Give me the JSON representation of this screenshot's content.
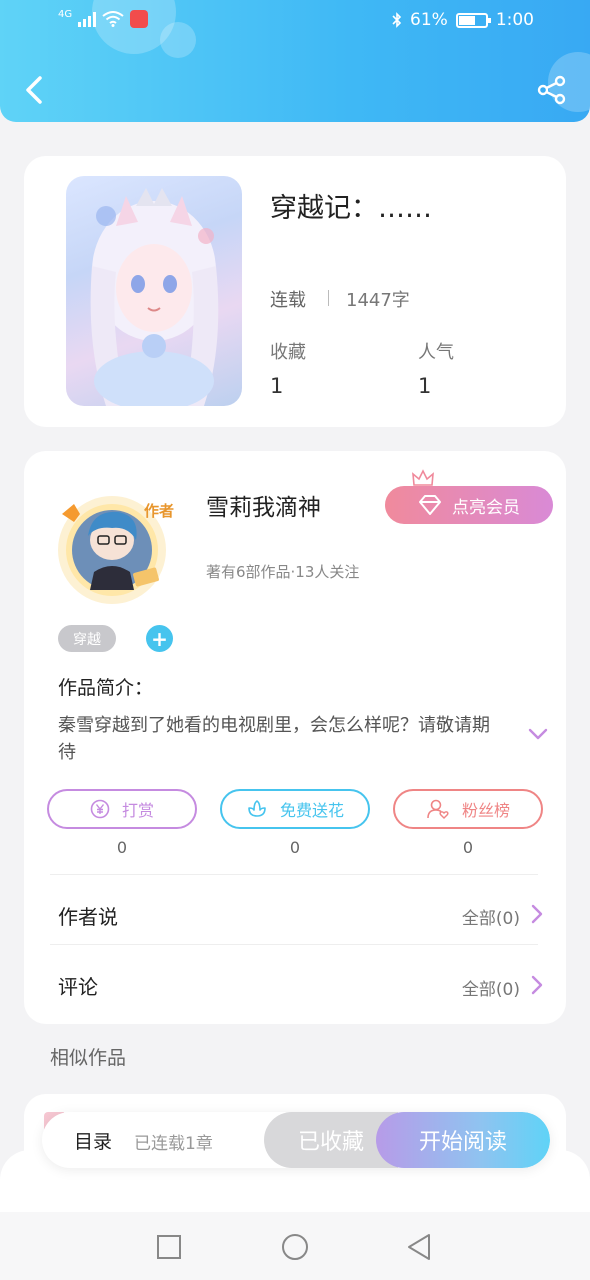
{
  "status_bar": {
    "network": "4G",
    "battery": "61%",
    "battery_level": 0.61,
    "time": "1:00"
  },
  "colors": {
    "header": "#3fb8f5",
    "accent_blue": "#46c4ee",
    "vip_pink": "#f08a9c",
    "reward_purple": "#c58be0",
    "flower_cyan": "#46c4ee",
    "fans_coral": "#ef8585"
  },
  "book": {
    "title": "穿越记：……",
    "status": "连载",
    "word_count": "1447字",
    "favorites_label": "收藏",
    "favorites_value": "1",
    "popularity_label": "人气",
    "popularity_value": "1"
  },
  "author": {
    "badge": "作者",
    "name": "雪莉我滴神",
    "stats": "著有6部作品·13人关注",
    "vip_button": "点亮会员"
  },
  "tags": [
    "穿越"
  ],
  "add_tag": "+",
  "intro": {
    "label": "作品简介：",
    "text": "秦雪穿越到了她看的电视剧里，会怎么样呢？请敬请期待"
  },
  "actions": [
    {
      "label": "打赏",
      "count": "0",
      "icon": "yen-coin-icon"
    },
    {
      "label": "免费送花",
      "count": "0",
      "icon": "flower-icon"
    },
    {
      "label": "粉丝榜",
      "count": "0",
      "icon": "fan-user-icon"
    }
  ],
  "author_says": {
    "title": "作者说",
    "link": "全部(0)"
  },
  "comments": {
    "title": "评论",
    "link": "全部(0)"
  },
  "similar_label": "相似作品",
  "bottom_bar": {
    "toc": "目录",
    "toc_status": "已连载1章",
    "favorited": "已收藏",
    "start_reading": "开始阅读"
  }
}
